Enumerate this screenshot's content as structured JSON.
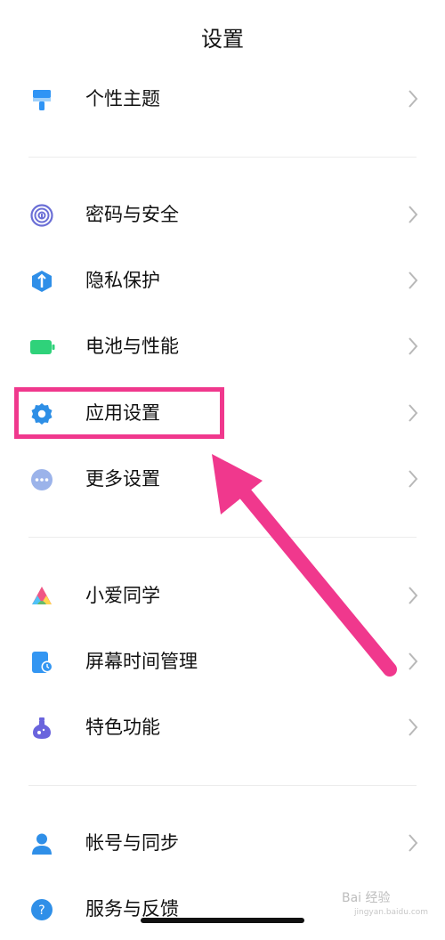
{
  "header": {
    "title": "设置"
  },
  "groups": [
    {
      "items": [
        {
          "label": "个性主题",
          "icon": "paint-brush-icon",
          "color": "#2f94f5"
        }
      ]
    },
    {
      "items": [
        {
          "label": "密码与安全",
          "icon": "fingerprint-icon",
          "color": "#6b6fd6"
        },
        {
          "label": "隐私保护",
          "icon": "privacy-shield-icon",
          "color": "#2f8fe8"
        },
        {
          "label": "电池与性能",
          "icon": "battery-icon",
          "color": "#2fd27a"
        },
        {
          "label": "应用设置",
          "icon": "gear-icon",
          "color": "#2e8fe6"
        },
        {
          "label": "更多设置",
          "icon": "more-dots-icon",
          "color": "#9bb3ea"
        }
      ]
    },
    {
      "items": [
        {
          "label": "小爱同学",
          "icon": "xiaoai-assistant-icon",
          "color": "#f05585"
        },
        {
          "label": "屏幕时间管理",
          "icon": "screen-time-icon",
          "color": "#3396f2"
        },
        {
          "label": "特色功能",
          "icon": "flask-icon",
          "color": "#6a64dd"
        }
      ]
    },
    {
      "items": [
        {
          "label": "帐号与同步",
          "icon": "user-account-icon",
          "color": "#2f8fe8"
        },
        {
          "label": "服务与反馈",
          "icon": "help-service-icon",
          "color": "#2f8fe8"
        }
      ]
    }
  ],
  "annotation": {
    "highlight_color": "#f0388d"
  },
  "watermark": {
    "text": "Bai 经验",
    "sub": "jingyan.baidu.com"
  }
}
